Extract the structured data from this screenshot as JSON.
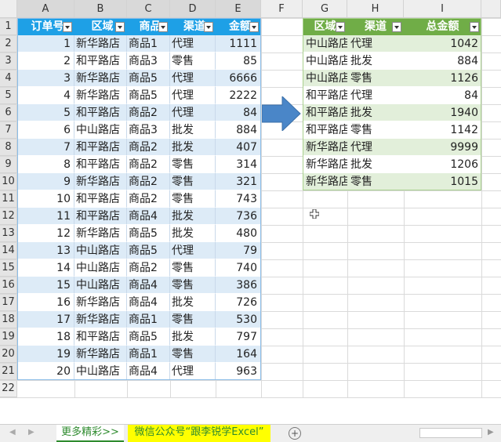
{
  "columns": [
    "A",
    "B",
    "C",
    "D",
    "E",
    "F",
    "G",
    "H",
    "I"
  ],
  "rows": [
    "1",
    "2",
    "3",
    "4",
    "5",
    "6",
    "7",
    "8",
    "9",
    "10",
    "11",
    "12",
    "13",
    "14",
    "15",
    "16",
    "17",
    "18",
    "19",
    "20",
    "21",
    "22"
  ],
  "left_table": {
    "headers": [
      "订单号",
      "区域",
      "商品",
      "渠道",
      "金额"
    ],
    "rows": [
      [
        "1",
        "新华路店",
        "商品1",
        "代理",
        "1111"
      ],
      [
        "2",
        "和平路店",
        "商品3",
        "零售",
        "85"
      ],
      [
        "3",
        "新华路店",
        "商品5",
        "代理",
        "6666"
      ],
      [
        "4",
        "新华路店",
        "商品5",
        "代理",
        "2222"
      ],
      [
        "5",
        "和平路店",
        "商品2",
        "代理",
        "84"
      ],
      [
        "6",
        "中山路店",
        "商品3",
        "批发",
        "884"
      ],
      [
        "7",
        "和平路店",
        "商品2",
        "批发",
        "407"
      ],
      [
        "8",
        "和平路店",
        "商品2",
        "零售",
        "314"
      ],
      [
        "9",
        "新华路店",
        "商品2",
        "零售",
        "321"
      ],
      [
        "10",
        "和平路店",
        "商品2",
        "零售",
        "743"
      ],
      [
        "11",
        "和平路店",
        "商品4",
        "批发",
        "736"
      ],
      [
        "12",
        "新华路店",
        "商品5",
        "批发",
        "480"
      ],
      [
        "13",
        "中山路店",
        "商品5",
        "代理",
        "79"
      ],
      [
        "14",
        "中山路店",
        "商品2",
        "零售",
        "740"
      ],
      [
        "15",
        "中山路店",
        "商品4",
        "零售",
        "386"
      ],
      [
        "16",
        "新华路店",
        "商品4",
        "批发",
        "726"
      ],
      [
        "17",
        "新华路店",
        "商品1",
        "零售",
        "530"
      ],
      [
        "18",
        "和平路店",
        "商品5",
        "批发",
        "797"
      ],
      [
        "19",
        "新华路店",
        "商品1",
        "零售",
        "164"
      ],
      [
        "20",
        "中山路店",
        "商品4",
        "代理",
        "963"
      ]
    ]
  },
  "right_table": {
    "headers": [
      "区域",
      "渠道",
      "总金额"
    ],
    "rows": [
      [
        "中山路店",
        "代理",
        "1042"
      ],
      [
        "中山路店",
        "批发",
        "884"
      ],
      [
        "中山路店",
        "零售",
        "1126"
      ],
      [
        "和平路店",
        "代理",
        "84"
      ],
      [
        "和平路店",
        "批发",
        "1940"
      ],
      [
        "和平路店",
        "零售",
        "1142"
      ],
      [
        "新华路店",
        "代理",
        "9999"
      ],
      [
        "新华路店",
        "批发",
        "1206"
      ],
      [
        "新华路店",
        "零售",
        "1015"
      ]
    ]
  },
  "sheet_tabs": [
    "更多精彩>>",
    "微信公众号“跟李锐学Excel”"
  ],
  "colors": {
    "left_header": "#1ea0e6",
    "left_band": "#ddebf7",
    "right_header": "#70ad47",
    "right_band": "#e2efda",
    "arrow": "#4a86c8",
    "tab_active": "#ffff00",
    "tab_text_active": "#2e8b2e"
  },
  "icons": [
    "filter-dropdown-icon",
    "arrow-right-icon",
    "add-sheet-icon",
    "scroll-left-icon",
    "scroll-right-icon",
    "cursor-icon"
  ]
}
